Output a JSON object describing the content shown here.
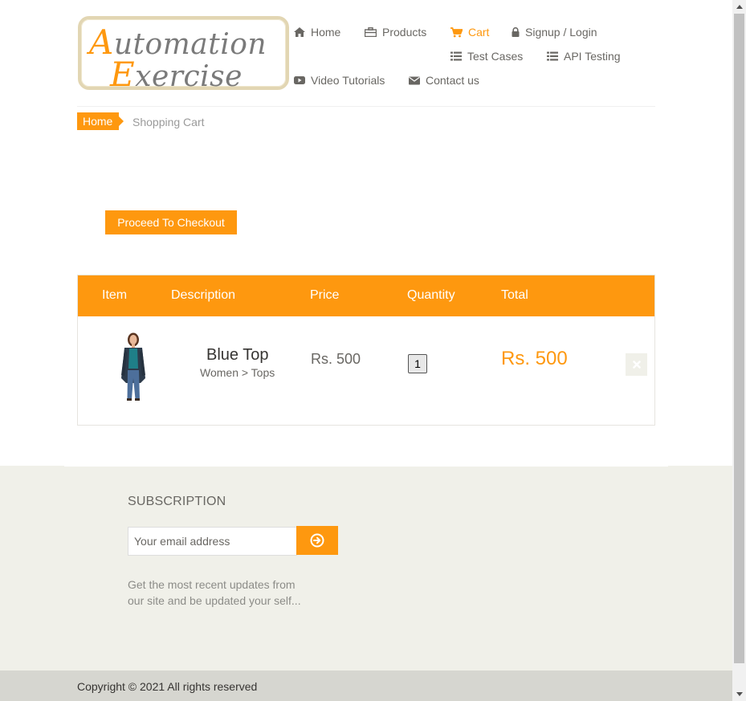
{
  "logo": {
    "line1_cap": "A",
    "line1_rest": "utomation",
    "line2_cap": "E",
    "line2_rest": "xercise"
  },
  "nav": {
    "home": "Home",
    "products": "Products",
    "cart": "Cart",
    "login": "Signup / Login",
    "test_cases": "Test Cases",
    "api_testing": "API Testing",
    "video_tutorials": "Video Tutorials",
    "contact_us": "Contact us"
  },
  "breadcrumb": {
    "home": "Home",
    "current": "Shopping Cart"
  },
  "checkout_label": "Proceed To Checkout",
  "cart": {
    "headers": {
      "item": "Item",
      "description": "Description",
      "price": "Price",
      "quantity": "Quantity",
      "total": "Total"
    },
    "items": [
      {
        "name": "Blue Top",
        "category": "Women > Tops",
        "price": "Rs. 500",
        "quantity": "1",
        "total": "Rs. 500"
      }
    ]
  },
  "footer": {
    "subscription_title": "SUBSCRIPTION",
    "email_placeholder": "Your email address",
    "subscription_text": "Get the most recent updates from our site and be updated your self...",
    "copyright": "Copyright © 2021 All rights reserved"
  },
  "colors": {
    "accent": "#fe980f",
    "footer_bg": "#f0f0e9",
    "footer_bottom_bg": "#d6d6d0"
  },
  "icons": {
    "home": "home-icon",
    "products": "briefcase-icon",
    "cart": "shopping-cart-icon",
    "login": "lock-icon",
    "test_cases": "list-icon",
    "api_testing": "list-icon",
    "video": "youtube-play-icon",
    "contact": "envelope-icon",
    "delete": "close-icon",
    "subscribe": "arrow-circle-right-icon"
  }
}
